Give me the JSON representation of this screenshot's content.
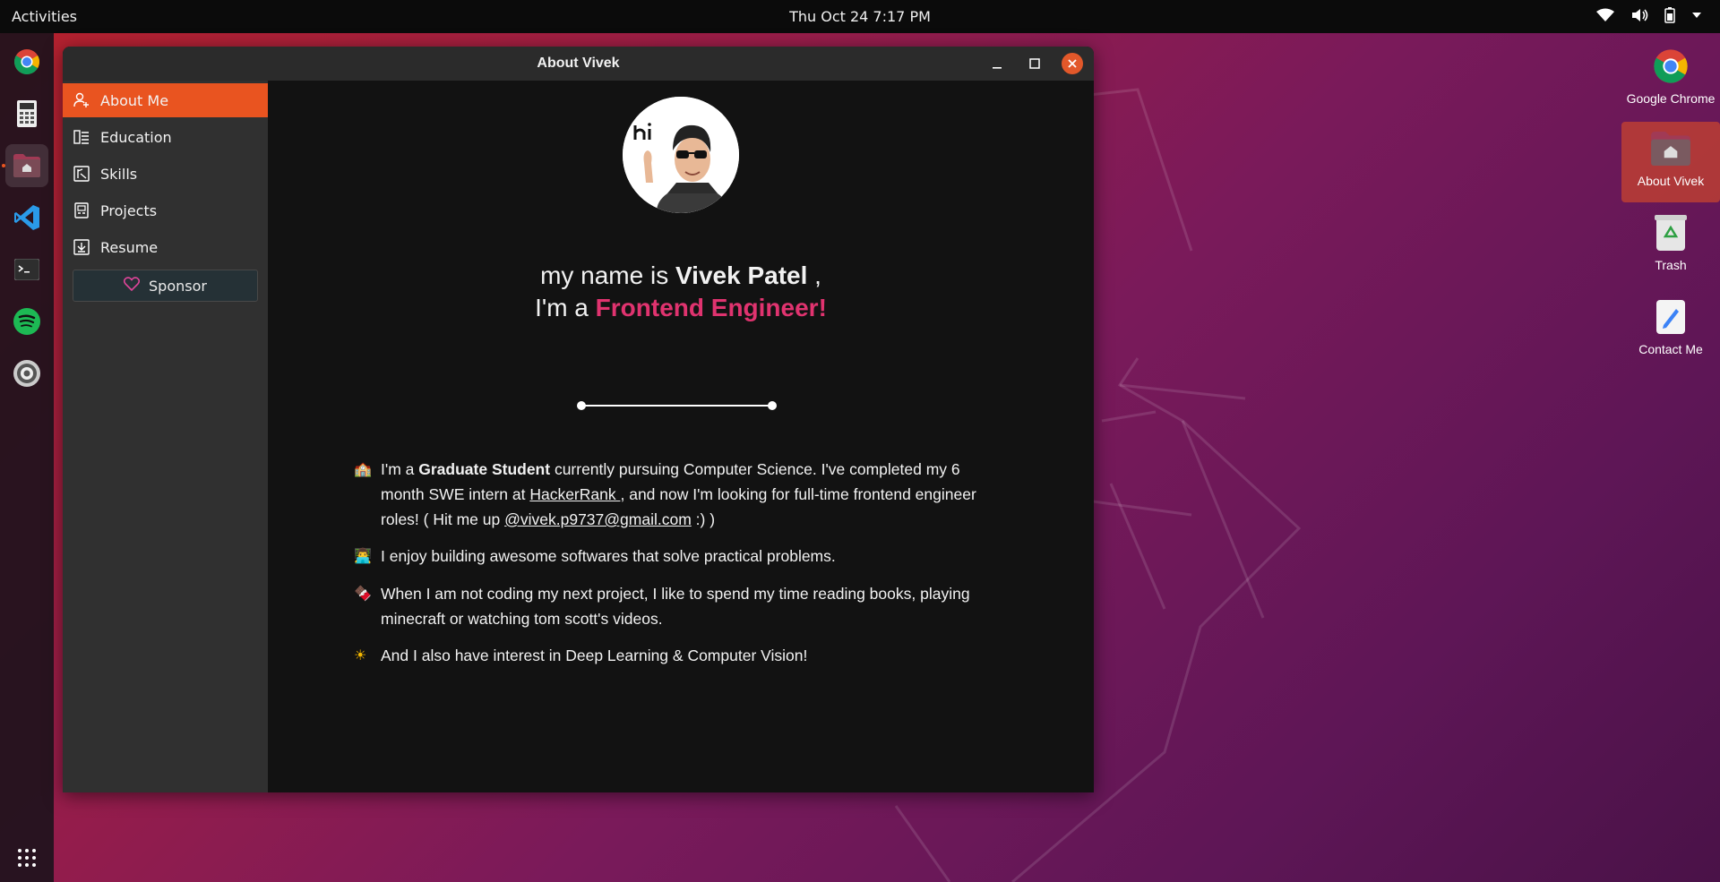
{
  "topbar": {
    "activities": "Activities",
    "clock": "Thu Oct 24  7:17 PM"
  },
  "dock": {
    "items": [
      "google-chrome",
      "calculator",
      "files",
      "vscode",
      "terminal",
      "spotify",
      "settings"
    ]
  },
  "window": {
    "title": "About Vivek",
    "sidebar": {
      "items": [
        {
          "label": "About Me",
          "icon": "person-add-icon"
        },
        {
          "label": "Education",
          "icon": "book-icon"
        },
        {
          "label": "Skills",
          "icon": "tools-icon"
        },
        {
          "label": "Projects",
          "icon": "projects-icon"
        },
        {
          "label": "Resume",
          "icon": "download-icon"
        }
      ],
      "sponsor": "Sponsor"
    },
    "main": {
      "line1_prefix": "my name is ",
      "name": "Vivek Patel",
      "line1_suffix": " ,",
      "line2_prefix": "I'm a ",
      "role": "Frontend Engineer!",
      "bullets": {
        "b1": {
          "emoji": "🏫",
          "t1": "I'm a ",
          "bold": "Graduate Student",
          "t2": " currently pursuing Computer Science. I've completed my 6 month SWE intern at ",
          "link1": "HackerRank ",
          "t3": ", and now I'm looking for full-time frontend engineer roles! ( Hit me up ",
          "link2": "@vivek.p9737@gmail.com",
          "t4": " :) )"
        },
        "b2": {
          "emoji": "👨‍💻",
          "text": "I enjoy building awesome softwares that solve practical problems."
        },
        "b3": {
          "emoji": "🍫",
          "text": "When I am not coding my next project, I like to spend my time reading books, playing minecraft or watching tom scott's videos."
        },
        "b4": {
          "emoji": "☀",
          "text": "And I also have interest in Deep Learning & Computer Vision!"
        }
      }
    }
  },
  "desktop": {
    "icons": [
      {
        "label": "Google Chrome"
      },
      {
        "label": "About Vivek"
      },
      {
        "label": "Trash"
      },
      {
        "label": "Contact Me"
      }
    ]
  },
  "colors": {
    "accent": "#e95420",
    "role": "#e0336f"
  }
}
